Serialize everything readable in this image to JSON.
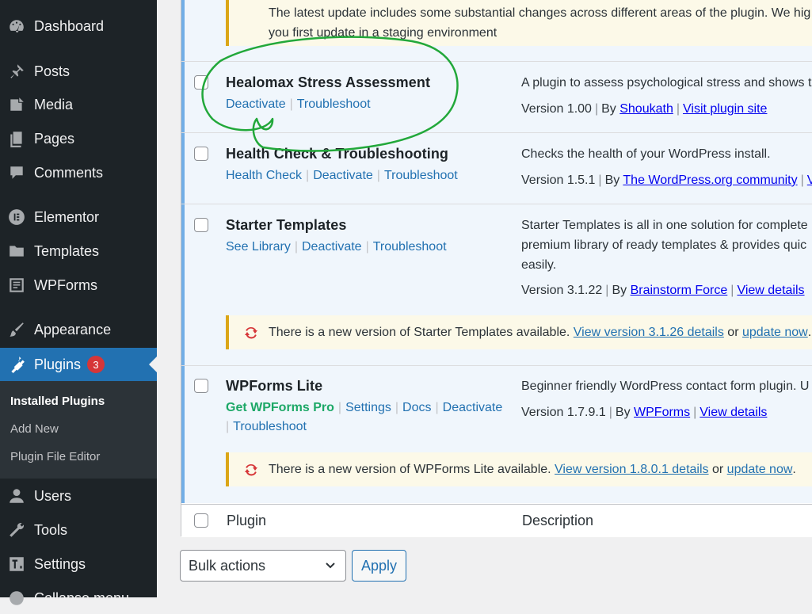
{
  "sidebar": {
    "items": [
      {
        "label": "Dashboard",
        "icon": "dashboard-icon"
      },
      {
        "label": "Posts",
        "icon": "pin-icon"
      },
      {
        "label": "Media",
        "icon": "media-icon"
      },
      {
        "label": "Pages",
        "icon": "pages-icon"
      },
      {
        "label": "Comments",
        "icon": "comment-icon"
      },
      {
        "label": "Elementor",
        "icon": "elementor-icon"
      },
      {
        "label": "Templates",
        "icon": "folder-icon"
      },
      {
        "label": "WPForms",
        "icon": "form-icon"
      },
      {
        "label": "Appearance",
        "icon": "brush-icon"
      },
      {
        "label": "Plugins",
        "icon": "plug-icon",
        "badge": "3",
        "current": true
      },
      {
        "label": "Users",
        "icon": "user-icon"
      },
      {
        "label": "Tools",
        "icon": "wrench-icon"
      },
      {
        "label": "Settings",
        "icon": "settings-icon"
      },
      {
        "label": "Collapse menu",
        "icon": "collapse-icon"
      }
    ],
    "submenu": [
      {
        "label": "Installed Plugins",
        "current": true
      },
      {
        "label": "Add New"
      },
      {
        "label": "Plugin File Editor"
      }
    ]
  },
  "top_notice": {
    "line1": "The latest update includes some substantial changes across different areas of the plugin. We hig",
    "line2": "you first update in a staging environment"
  },
  "plugins": [
    {
      "name": "Healomax Stress Assessment",
      "actions": [
        "Deactivate",
        "Troubleshoot"
      ],
      "description": "A plugin to assess psychological stress and shows th",
      "version": "Version 1.00",
      "by_label": "By",
      "author": "Shoukath",
      "extra_link": "Visit plugin site"
    },
    {
      "name": "Health Check & Troubleshooting",
      "actions": [
        "Health Check",
        "Deactivate",
        "Troubleshoot"
      ],
      "description": "Checks the health of your WordPress install.",
      "version": "Version 1.5.1",
      "by_label": "By",
      "author": "The WordPress.org community",
      "extra_link": "V"
    },
    {
      "name": "Starter Templates",
      "actions": [
        "See Library",
        "Deactivate",
        "Troubleshoot"
      ],
      "description_lines": [
        "Starter Templates is all in one solution for complete",
        "premium library of ready templates & provides quic",
        "easily."
      ],
      "version": "Version 3.1.22",
      "by_label": "By",
      "author": "Brainstorm Force",
      "extra_link": "View details",
      "update_notice": {
        "text": "There is a new version of Starter Templates available.",
        "view_link": "View version 3.1.26 details",
        "or": "or",
        "update_link": "update now",
        "end": "."
      }
    },
    {
      "name": "WPForms Lite",
      "actions": [
        "Get WPForms Pro",
        "Settings",
        "Docs",
        "Deactivate",
        "Troubleshoot"
      ],
      "description": "Beginner friendly WordPress contact form plugin. U",
      "version": "Version 1.7.9.1",
      "by_label": "By",
      "author": "WPForms",
      "extra_link": "View details",
      "update_notice": {
        "text": "There is a new version of WPForms Lite available.",
        "view_link": "View version 1.8.0.1 details",
        "or": "or",
        "update_link": "update now",
        "end": "."
      }
    }
  ],
  "table_footer": {
    "col_plugin": "Plugin",
    "col_description": "Description"
  },
  "bulk": {
    "select_value": "Bulk actions",
    "apply": "Apply"
  },
  "colors": {
    "sidebar_bg": "#1d2327",
    "accent": "#2271b1",
    "badge": "#d63638",
    "annotation": "#22a83a",
    "notice_border": "#dba617"
  }
}
